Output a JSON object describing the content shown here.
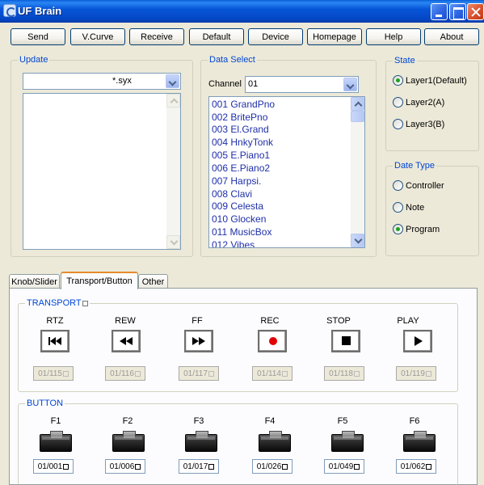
{
  "window": {
    "title": "UF Brain"
  },
  "toolbar": {
    "buttons": [
      "Send",
      "V.Curve",
      "Receive",
      "Default",
      "Device",
      "Homepage",
      "Help",
      "About"
    ]
  },
  "update": {
    "title": "Update",
    "file_filter": "*.syx"
  },
  "data_select": {
    "title": "Data Select",
    "channel_label": "Channel",
    "channel_value": "01",
    "items": [
      "001 GrandPno",
      "002 BritePno",
      "003 El.Grand",
      "004 HnkyTonk",
      "005 E.Piano1",
      "006 E.Piano2",
      "007 Harpsi.",
      "008 Clavi",
      "009 Celesta",
      "010 Glocken",
      "011 MusicBox",
      "012 Vibes"
    ]
  },
  "state": {
    "title": "State",
    "options": [
      "Layer1(Default)",
      "Layer2(A)",
      "Layer3(B)"
    ],
    "selected": 0
  },
  "date_type": {
    "title": "Date Type",
    "options": [
      "Controller",
      "Note",
      "Program"
    ],
    "selected": 2
  },
  "tabs": [
    "Knob/Slider",
    "Transport/Button",
    "Other"
  ],
  "transport": {
    "title": "TRANSPORT",
    "controls": [
      {
        "label": "RTZ",
        "code": "01/115"
      },
      {
        "label": "REW",
        "code": "01/116"
      },
      {
        "label": "FF",
        "code": "01/117"
      },
      {
        "label": "REC",
        "code": "01/114"
      },
      {
        "label": "STOP",
        "code": "01/118"
      },
      {
        "label": "PLAY",
        "code": "01/119"
      }
    ]
  },
  "button_section": {
    "title": "BUTTON",
    "controls": [
      {
        "label": "F1",
        "code": "01/001"
      },
      {
        "label": "F2",
        "code": "01/006"
      },
      {
        "label": "F3",
        "code": "01/017"
      },
      {
        "label": "F4",
        "code": "01/026"
      },
      {
        "label": "F5",
        "code": "01/049"
      },
      {
        "label": "F6",
        "code": "01/062"
      }
    ]
  },
  "colors": {
    "titlebar": "#0756d8",
    "group_title": "#0046d5",
    "list_text": "#1f2fa8",
    "tab_accent": "#e68b2c",
    "rec_dot": "#e00000"
  }
}
